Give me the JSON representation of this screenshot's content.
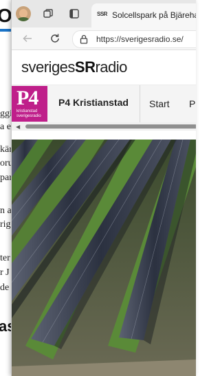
{
  "background_window": {
    "heading": "ON",
    "lines": [
      "ggi",
      "a e",
      "kär",
      "oru",
      "par",
      "n a",
      "rig",
      "ter",
      "r J",
      "de"
    ],
    "subheading": "as"
  },
  "tab": {
    "favicon_text": "SSR",
    "title": "Solcellspark på Bjärehalvön"
  },
  "address_bar": {
    "url": "https://sverigesradio.se/"
  },
  "site": {
    "brand_prefix": "sveriges",
    "brand_mark": "SR",
    "brand_suffix": "radio"
  },
  "channel": {
    "logo_text": "P4",
    "logo_sub1": "kristianstad",
    "logo_sub2": "sverigesradio",
    "name": "P4 Kristianstad",
    "nav": [
      "Start",
      "P"
    ]
  },
  "colors": {
    "p4_brand": "#bf1f8a",
    "photo_grass": "#4d7a32",
    "panel": "#1d2333"
  },
  "photo": {
    "icon": "solar-park-photo"
  }
}
